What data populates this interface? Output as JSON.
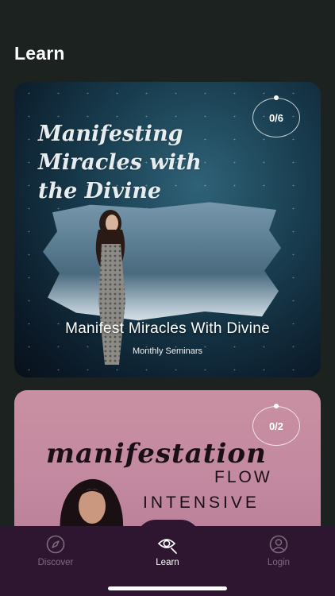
{
  "page": {
    "title": "Learn"
  },
  "cards": [
    {
      "title": "Manifest Miracles With Divine",
      "subtitle": "Monthly Seminars",
      "progress": "0/6",
      "artwork_text": [
        "Manifesting",
        "Miracles with",
        "the Divine"
      ]
    },
    {
      "progress": "0/2",
      "artwork_text": [
        "manifestation",
        "FLOW",
        "INTENSIVE"
      ]
    }
  ],
  "tabbar": {
    "items": [
      {
        "label": "Discover",
        "icon": "compass-icon",
        "active": false
      },
      {
        "label": "Learn",
        "icon": "eye-search-icon",
        "active": true
      },
      {
        "label": "Login",
        "icon": "user-icon",
        "active": false
      }
    ]
  },
  "colors": {
    "background": "#1c2220",
    "tabbar": "#2e1630",
    "inactive_tab": "#7c6c7e"
  }
}
